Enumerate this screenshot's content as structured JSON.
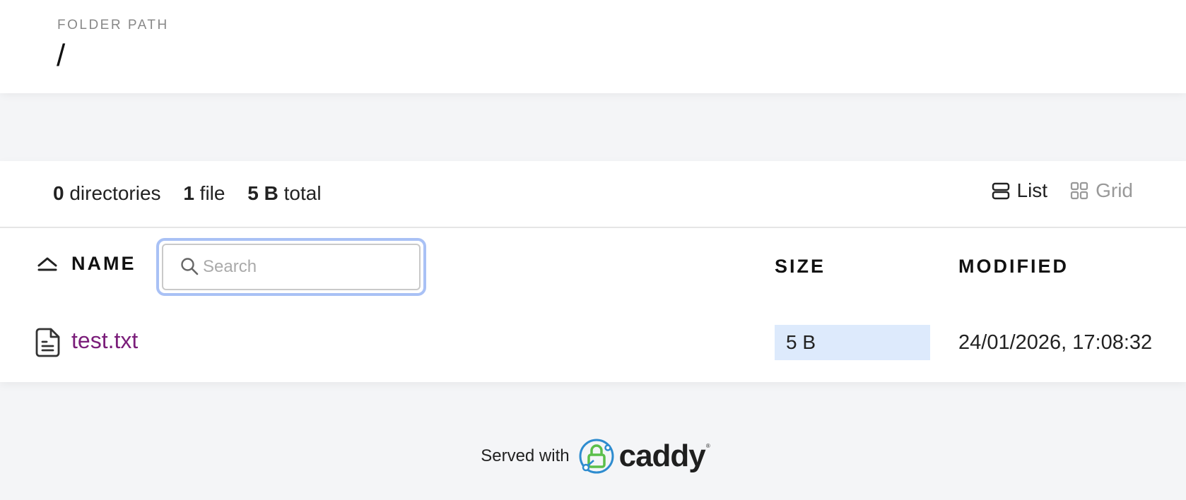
{
  "header": {
    "label": "FOLDER PATH",
    "path": "/"
  },
  "summary": {
    "dirs_count": "0",
    "dirs_label": "directories",
    "files_count": "1",
    "files_label": "file",
    "total_size": "5 B",
    "total_label": "total"
  },
  "view": {
    "list_label": "List",
    "grid_label": "Grid",
    "active": "List"
  },
  "table": {
    "col_name": "NAME",
    "col_size": "SIZE",
    "col_modified": "MODIFIED",
    "search_placeholder": "Search",
    "rows": [
      {
        "name": "test.txt",
        "size": "5 B",
        "modified": "24/01/2026, 17:08:32",
        "icon": "file-text-icon"
      }
    ]
  },
  "footer": {
    "served_with": "Served with",
    "brand": "caddy"
  },
  "colors": {
    "link": "#7b1e7a",
    "focus_ring": "#a9c1f5",
    "size_highlight": "#ddeafc",
    "page_bg": "#f4f5f7"
  }
}
